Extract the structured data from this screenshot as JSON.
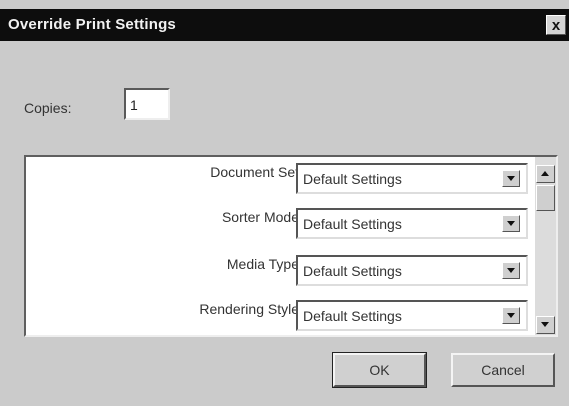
{
  "dialog": {
    "title": "Override Print Settings",
    "close_glyph": "x"
  },
  "copies": {
    "label": "Copies:",
    "value": "1"
  },
  "settings": [
    {
      "label": "Document Set",
      "value": "Default Settings"
    },
    {
      "label": "Sorter Mode",
      "value": "Default Settings"
    },
    {
      "label": "Media Type",
      "value": "Default Settings"
    },
    {
      "label": "Rendering Style",
      "value": "Default Settings"
    }
  ],
  "buttons": {
    "ok": "OK",
    "cancel": "Cancel"
  },
  "icons": {
    "close": "close-icon",
    "dropdown": "chevron-down-icon",
    "scroll_up": "scroll-up-icon",
    "scroll_down": "scroll-down-icon"
  },
  "colors": {
    "titlebar": "#0d0d0d",
    "dialog_bg": "#cbcbcb",
    "pane_bg": "#ffffff"
  }
}
